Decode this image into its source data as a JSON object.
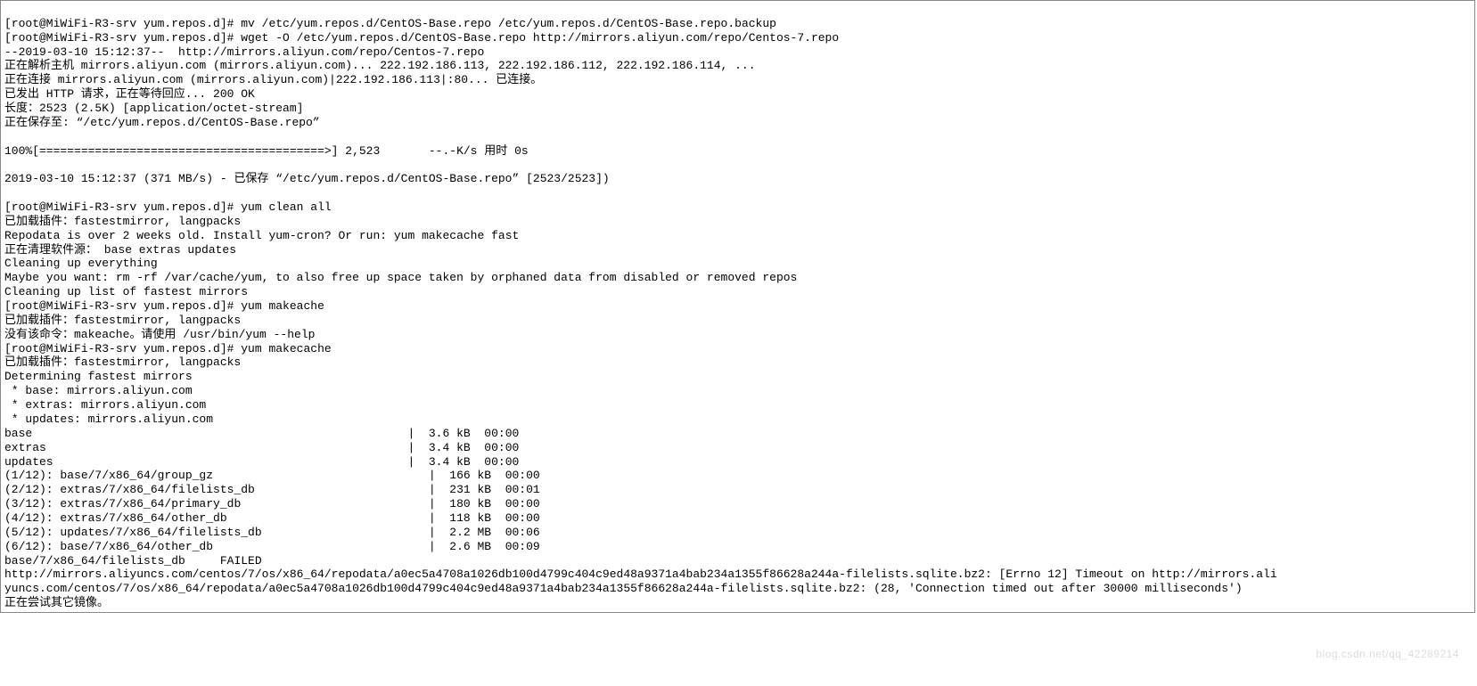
{
  "prompt": "[root@MiWiFi-R3-srv yum.repos.d]# ",
  "cmds": {
    "mv": "mv /etc/yum.repos.d/CentOS-Base.repo /etc/yum.repos.d/CentOS-Base.repo.backup",
    "wget": "wget -O /etc/yum.repos.d/CentOS-Base.repo http://mirrors.aliyun.com/repo/Centos-7.repo",
    "clean": "yum clean all",
    "makeache": "yum makeache",
    "makecache": "yum makecache"
  },
  "wget_out": {
    "l1": "--2019-03-10 15:12:37--  http://mirrors.aliyun.com/repo/Centos-7.repo",
    "l2": "正在解析主机 mirrors.aliyun.com (mirrors.aliyun.com)... 222.192.186.113, 222.192.186.112, 222.192.186.114, ...",
    "l3": "正在连接 mirrors.aliyun.com (mirrors.aliyun.com)|222.192.186.113|:80... 已连接。",
    "l4": "已发出 HTTP 请求，正在等待回应... 200 OK",
    "l5": "长度：2523 (2.5K) [application/octet-stream]",
    "l6": "正在保存至: “/etc/yum.repos.d/CentOS-Base.repo”",
    "progress": "100%[=========================================>] 2,523       --.-K/s 用时 0s",
    "done": "2019-03-10 15:12:37 (371 MB/s) - 已保存 “/etc/yum.repos.d/CentOS-Base.repo” [2523/2523])"
  },
  "clean_out": {
    "l1": "已加载插件：fastestmirror, langpacks",
    "l2": "Repodata is over 2 weeks old. Install yum-cron? Or run: yum makecache fast",
    "l3": "正在清理软件源： base extras updates",
    "l4": "Cleaning up everything",
    "l5": "Maybe you want: rm -rf /var/cache/yum, to also free up space taken by orphaned data from disabled or removed repos",
    "l6": "Cleaning up list of fastest mirrors"
  },
  "makeache_out": {
    "l1": "已加载插件：fastestmirror, langpacks",
    "l2": "没有该命令：makeache。请使用 /usr/bin/yum --help"
  },
  "makecache_out": {
    "l1": "已加载插件：fastestmirror, langpacks",
    "l2": "Determining fastest mirrors",
    "l3": " * base: mirrors.aliyun.com",
    "l4": " * extras: mirrors.aliyun.com",
    "l5": " * updates: mirrors.aliyun.com"
  },
  "repos": [
    {
      "name": "base",
      "size": "3.6 kB",
      "time": "00:00"
    },
    {
      "name": "extras",
      "size": "3.4 kB",
      "time": "00:00"
    },
    {
      "name": "updates",
      "size": "3.4 kB",
      "time": "00:00"
    }
  ],
  "dl": [
    {
      "idx": "(1/12):",
      "name": "base/7/x86_64/group_gz",
      "size": "166 kB",
      "time": "00:00"
    },
    {
      "idx": "(2/12):",
      "name": "extras/7/x86_64/filelists_db",
      "size": "231 kB",
      "time": "00:01"
    },
    {
      "idx": "(3/12):",
      "name": "extras/7/x86_64/primary_db",
      "size": "180 kB",
      "time": "00:00"
    },
    {
      "idx": "(4/12):",
      "name": "extras/7/x86_64/other_db",
      "size": "118 kB",
      "time": "00:00"
    },
    {
      "idx": "(5/12):",
      "name": "updates/7/x86_64/filelists_db",
      "size": "2.2 MB",
      "time": "00:06"
    },
    {
      "idx": "(6/12):",
      "name": "base/7/x86_64/other_db",
      "size": "2.6 MB",
      "time": "00:09"
    }
  ],
  "fail": {
    "l1": "base/7/x86_64/filelists_db     FAILED",
    "l2": "http://mirrors.aliyuncs.com/centos/7/os/x86_64/repodata/a0ec5a4708a1026db100d4799c404c9ed48a9371a4bab234a1355f86628a244a-filelists.sqlite.bz2: [Errno 12] Timeout on http://mirrors.ali",
    "l3": "yuncs.com/centos/7/os/x86_64/repodata/a0ec5a4708a1026db100d4799c404c9ed48a9371a4bab234a1355f86628a244a-filelists.sqlite.bz2: (28, 'Connection timed out after 30000 milliseconds')",
    "l4": "正在尝试其它镜像。"
  },
  "watermark": "blog.csdn.net/qq_42289214"
}
